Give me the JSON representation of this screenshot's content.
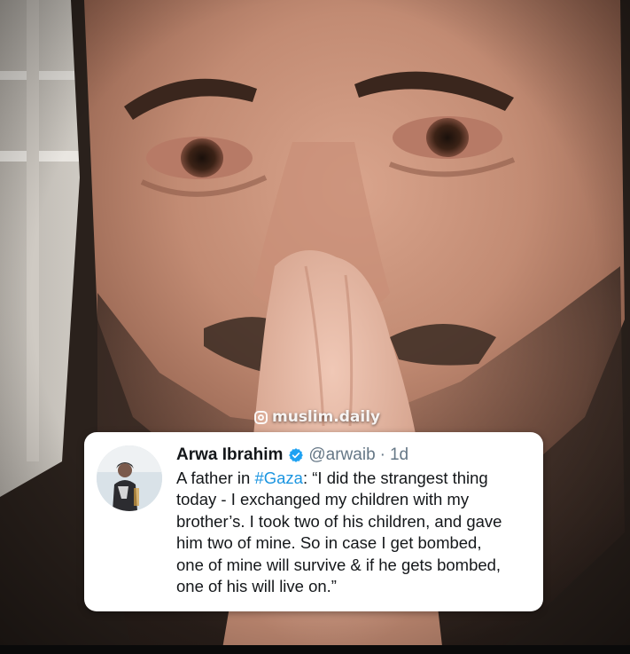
{
  "watermark": {
    "icon": "instagram-icon",
    "text": "muslim.daily"
  },
  "tweet": {
    "author_name": "Arwa Ibrahim",
    "verified_icon": "verified-badge-icon",
    "handle": "@arwaib",
    "separator": "·",
    "time": "1d",
    "lines": {
      "l1_before": "A father in ",
      "l1_hashtag": "#Gaza",
      "l1_after": ": “I did the strangest thing",
      "l2": "today - I exchanged my children with my",
      "l3": "brother’s. I took two of his children, and gave",
      "l4": "him two of mine. So in case I get bombed,",
      "l5": "one of mine will survive & if he gets bombed,",
      "l6": "one of his will live on.”"
    }
  },
  "colors": {
    "hashtag": "#1b95e0",
    "verified": "#1da1f2",
    "meta_gray": "#657786",
    "card_bg": "#ffffff"
  }
}
